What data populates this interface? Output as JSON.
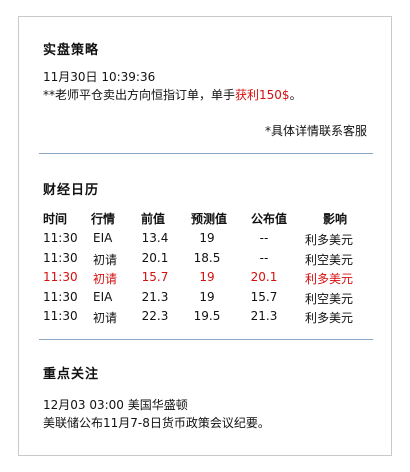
{
  "strategy": {
    "title": "实盘策略",
    "timestamp": "11月30日 10:39:36",
    "message_prefix": "**老师平仓卖出方向恒指订单，单手",
    "profit_label": "获利",
    "profit_amount": "150$",
    "message_suffix": "。",
    "note": "*具体详情联系客服"
  },
  "calendar": {
    "title": "财经日历",
    "columns": [
      "时间",
      "行情",
      "前值",
      "预测值",
      "公布值",
      "影响"
    ],
    "rows": [
      {
        "time": "11:30",
        "item": "EIA",
        "previous": "13.4",
        "forecast": "19",
        "actual": "--",
        "impact": "利多美元",
        "highlight": false
      },
      {
        "time": "11:30",
        "item": "初请",
        "previous": "20.1",
        "forecast": "18.5",
        "actual": "--",
        "impact": "利空美元",
        "highlight": false
      },
      {
        "time": "11:30",
        "item": "初请",
        "previous": "15.7",
        "forecast": "19",
        "actual": "20.1",
        "impact": "利多美元",
        "highlight": true
      },
      {
        "time": "11:30",
        "item": "EIA",
        "previous": "21.3",
        "forecast": "19",
        "actual": "15.7",
        "impact": "利空美元",
        "highlight": false
      },
      {
        "time": "11:30",
        "item": "初请",
        "previous": "22.3",
        "forecast": "19.5",
        "actual": "21.3",
        "impact": "利多美元",
        "highlight": false
      }
    ],
    "highlight_color": "#d60f0f"
  },
  "focus": {
    "title": "重点关注",
    "date": "12月03 03:00",
    "location": "美国华盛顿",
    "description": "美联储公布11月7-8日货币政策会议纪要。"
  },
  "colors": {
    "divider": "#8aa6c4",
    "border": "#c9c9c9",
    "accent_red": "#d60f0f"
  }
}
